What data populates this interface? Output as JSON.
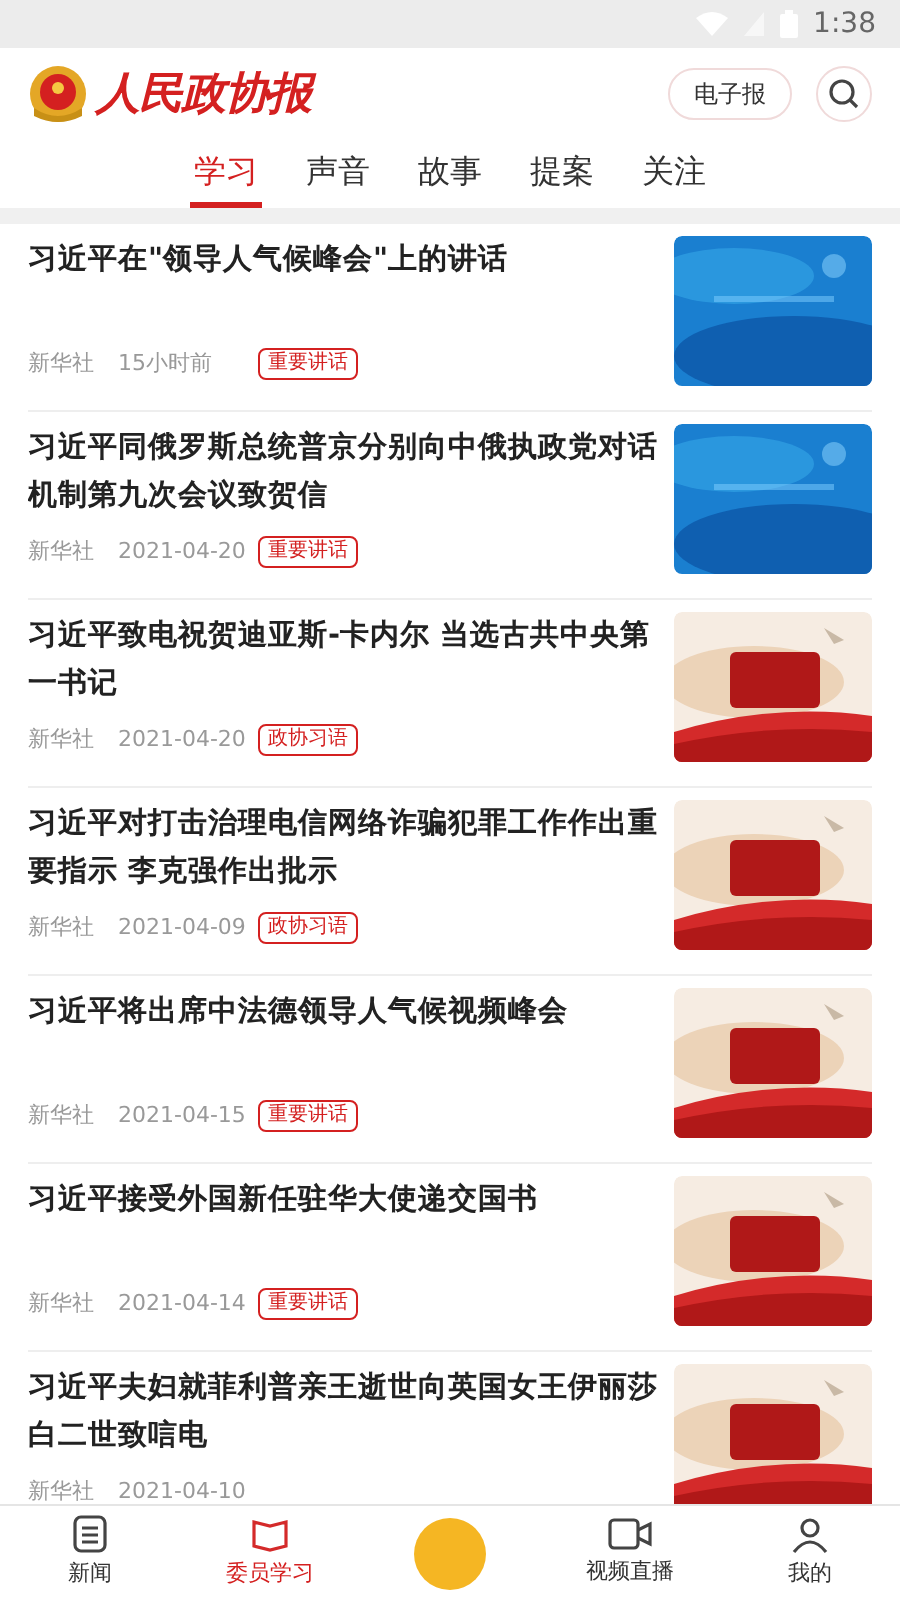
{
  "status_bar": {
    "time": "1:38"
  },
  "header": {
    "logo_text": "人民政协报",
    "epaper_button": "电子报"
  },
  "tabs": [
    {
      "label": "学习",
      "selected": true
    },
    {
      "label": "声音",
      "selected": false
    },
    {
      "label": "故事",
      "selected": false
    },
    {
      "label": "提案",
      "selected": false
    },
    {
      "label": "关注",
      "selected": false
    }
  ],
  "articles": [
    {
      "title": "习近平在\"领导人气候峰会\"上的讲话",
      "source": "新华社",
      "time": "15小时前",
      "tag": "重要讲话",
      "kind": "blue"
    },
    {
      "title": "习近平同俄罗斯总统普京分别向中俄执政党对话机制第九次会议致贺信",
      "source": "新华社",
      "time": "2021-04-20",
      "tag": "重要讲话",
      "kind": "blue"
    },
    {
      "title": "习近平致电祝贺迪亚斯-卡内尔 当选古共中央第一书记",
      "source": "新华社",
      "time": "2021-04-20",
      "tag": "政协习语",
      "kind": "red"
    },
    {
      "title": "习近平对打击治理电信网络诈骗犯罪工作作出重要指示 李克强作出批示",
      "source": "新华社",
      "time": "2021-04-09",
      "tag": "政协习语",
      "kind": "red"
    },
    {
      "title": "习近平将出席中法德领导人气候视频峰会",
      "source": "新华社",
      "time": "2021-04-15",
      "tag": "重要讲话",
      "kind": "red"
    },
    {
      "title": "习近平接受外国新任驻华大使递交国书",
      "source": "新华社",
      "time": "2021-04-14",
      "tag": "重要讲话",
      "kind": "red"
    },
    {
      "title": "习近平夫妇就菲利普亲王逝世向英国女王伊丽莎白二世致唁电",
      "source": "新华社",
      "time": "2021-04-10",
      "kind": "red"
    }
  ],
  "bottom_nav": [
    {
      "label": "新闻",
      "kind": "doc",
      "selected": false
    },
    {
      "label": "委员学习",
      "kind": "study",
      "selected": true
    },
    {
      "kind": "center",
      "selected": false
    },
    {
      "label": "视频直播",
      "kind": "video",
      "selected": false
    },
    {
      "label": "我的",
      "kind": "user",
      "selected": false
    }
  ]
}
